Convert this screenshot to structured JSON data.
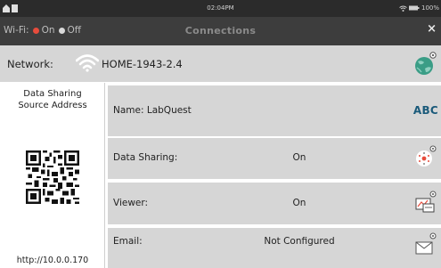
{
  "status_bar": {
    "time": "02:04PM",
    "battery": "100%"
  },
  "titlebar": {
    "wifi_label": "Wi-Fi:",
    "wifi_on_label": "On",
    "wifi_off_label": "Off",
    "wifi_selected": "On",
    "title": "Connections",
    "close_label": "×"
  },
  "network": {
    "label": "Network:",
    "ssid": "HOME-1943-2.4"
  },
  "qr_panel": {
    "caption_line1": "Data Sharing",
    "caption_line2": "Source Address",
    "url": "http://10.0.0.170"
  },
  "rows": [
    {
      "label": "Name: LabQuest",
      "value": "",
      "icon": "abc-text-icon",
      "icon_text": "ABC"
    },
    {
      "label": "Data Sharing:",
      "value": "On",
      "icon": "data-sharing-icon"
    },
    {
      "label": "Viewer:",
      "value": "On",
      "icon": "viewer-icon"
    },
    {
      "label": "Email:",
      "value": "Not Configured",
      "icon": "email-icon"
    }
  ],
  "colors": {
    "accent_on": "#e74c3c",
    "row_bg": "#d6d6d6",
    "titlebar_bg": "#3d3d3d",
    "statusbar_bg": "#2b2b2b"
  }
}
